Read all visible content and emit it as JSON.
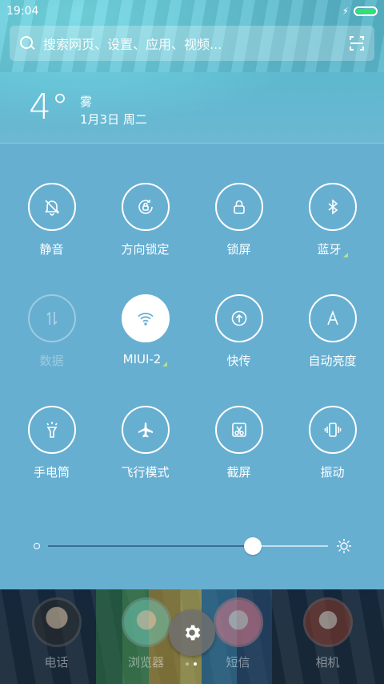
{
  "status_bar": {
    "time": "19:04",
    "battery_color": "#2fe36b"
  },
  "search": {
    "placeholder": "搜索网页、设置、应用、视频..."
  },
  "weather": {
    "temperature": "4°",
    "condition": "雾",
    "date": "1月3日 周二"
  },
  "toggles": [
    {
      "label": "静音",
      "icon": "silent-bell-icon",
      "state": "off"
    },
    {
      "label": "方向锁定",
      "icon": "rotation-lock-icon",
      "state": "off"
    },
    {
      "label": "锁屏",
      "icon": "lock-icon",
      "state": "off"
    },
    {
      "label": "蓝牙",
      "icon": "bluetooth-icon",
      "state": "off"
    },
    {
      "label": "数据",
      "icon": "data-arrows-icon",
      "state": "disabled"
    },
    {
      "label": "MIUI-2",
      "icon": "wifi-icon",
      "state": "on"
    },
    {
      "label": "快传",
      "icon": "quick-transfer-icon",
      "state": "off"
    },
    {
      "label": "自动亮度",
      "icon": "auto-brightness-icon",
      "state": "off"
    },
    {
      "label": "手电筒",
      "icon": "flashlight-icon",
      "state": "off"
    },
    {
      "label": "飞行模式",
      "icon": "airplane-icon",
      "state": "off"
    },
    {
      "label": "截屏",
      "icon": "screenshot-icon",
      "state": "off"
    },
    {
      "label": "振动",
      "icon": "vibrate-icon",
      "state": "off"
    }
  ],
  "brightness": {
    "level": 0.73
  },
  "dock": {
    "apps": [
      {
        "label": "电话"
      },
      {
        "label": "浏览器"
      },
      {
        "label": "短信"
      },
      {
        "label": "相机"
      }
    ]
  },
  "colors": {
    "panel": "#67afd1",
    "active_icon": "#67afd1",
    "fill": "#3e6b9a"
  }
}
